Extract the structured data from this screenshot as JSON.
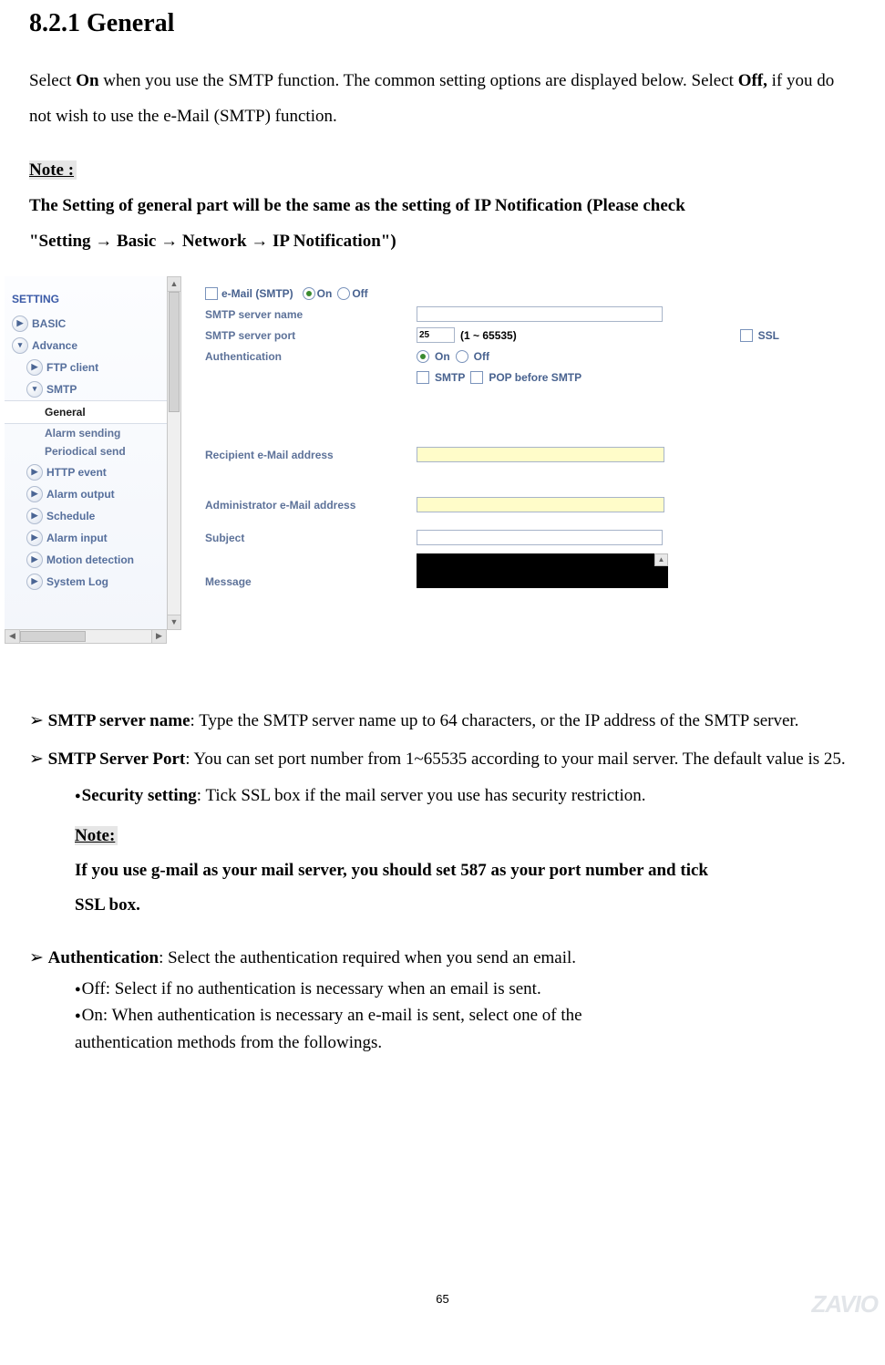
{
  "heading": "8.2.1 General",
  "intro": {
    "pre": "Select ",
    "on": "On",
    "mid": " when you use the SMTP function. The common setting options are displayed below. Select ",
    "off": "Off,",
    "post": " if you do not wish to use the e-Mail (SMTP) function."
  },
  "note": {
    "label": "Note :",
    "line1": "The Setting of general part will be the same as the setting of IP Notification (Please check",
    "line2": "\"Setting → Basic → Network → IP Notification\")"
  },
  "sidebar": {
    "heading": "SETTING",
    "items": [
      {
        "label": "BASIC",
        "type": "collapsed",
        "name": "sidebar-basic"
      },
      {
        "label": "Advance",
        "type": "expanded",
        "name": "sidebar-advance"
      },
      {
        "label": "FTP client",
        "type": "sub-collapsed",
        "name": "sidebar-ftp"
      },
      {
        "label": "SMTP",
        "type": "sub-expanded",
        "name": "sidebar-smtp"
      },
      {
        "label": "General",
        "type": "leaf-selected",
        "name": "sidebar-general"
      },
      {
        "label": "Alarm sending",
        "type": "leaf",
        "name": "sidebar-alarm-sending"
      },
      {
        "label": "Periodical send",
        "type": "leaf",
        "name": "sidebar-periodical"
      },
      {
        "label": "HTTP event",
        "type": "sub-collapsed",
        "name": "sidebar-http"
      },
      {
        "label": "Alarm output",
        "type": "sub-collapsed",
        "name": "sidebar-alarm-output"
      },
      {
        "label": "Schedule",
        "type": "sub-collapsed",
        "name": "sidebar-schedule"
      },
      {
        "label": "Alarm input",
        "type": "sub-collapsed",
        "name": "sidebar-alarm-input"
      },
      {
        "label": "Motion detection",
        "type": "sub-collapsed",
        "name": "sidebar-motion"
      },
      {
        "label": "System Log",
        "type": "sub-collapsed",
        "name": "sidebar-syslog"
      }
    ]
  },
  "form": {
    "email_label": "e-Mail (SMTP)",
    "on": "On",
    "off": "Off",
    "server_name": "SMTP server name",
    "server_port": "SMTP server port",
    "port_value": "25",
    "port_range": "(1 ~ 65535)",
    "ssl": "SSL",
    "auth": "Authentication",
    "smtp_cb": "SMTP",
    "pop_cb": "POP before SMTP",
    "recipient": "Recipient e-Mail address",
    "admin": "Administrator e-Mail address",
    "subject": "Subject",
    "message": "Message"
  },
  "bullets": {
    "b1_head": "SMTP server name",
    "b1_body": ": Type the SMTP server name up to 64 characters, or the IP address of the SMTP server.",
    "b2_head": "SMTP Server Port",
    "b2_body": ": You can set port number from 1~65535 according to your mail server. The default value is 25.",
    "sec_head": "Security setting",
    "sec_body": ": Tick SSL box if the mail server you use has security restriction.",
    "note2_label": "Note:",
    "note2_l1": "If you use g-mail as your mail server, you should set 587 as your port number and tick",
    "note2_l2": "SSL box.",
    "b3_head": "Authentication",
    "b3_body": ": Select the authentication required when you send an email.",
    "auth_off": "Off: Select if no authentication is necessary when an email is sent.",
    "auth_on1": "On: When authentication is necessary an e-mail is sent, select one of the",
    "auth_on2": "authentication methods from the followings."
  },
  "page_number": "65",
  "watermark": "ZAVIO"
}
